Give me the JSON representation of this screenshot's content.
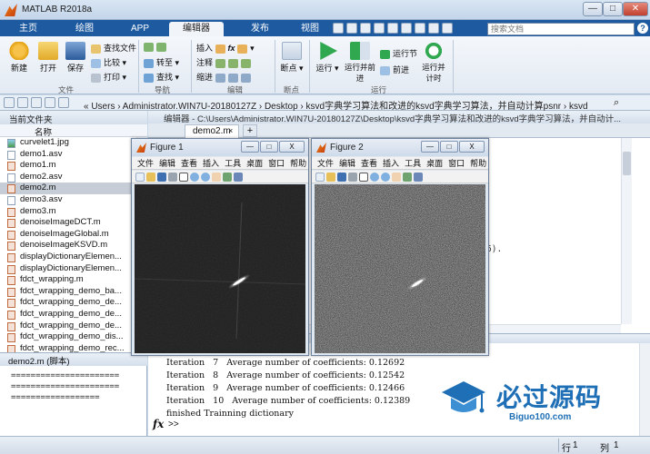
{
  "window": {
    "title": "MATLAB R2018a"
  },
  "tabs": [
    "主页",
    "绘图",
    "APP",
    "编辑器",
    "发布",
    "视图"
  ],
  "active_tab": 3,
  "search": {
    "placeholder": "搜索文档"
  },
  "ribbon": {
    "file_group": {
      "label": "文件",
      "new": "新建",
      "open": "打开",
      "save": "保存",
      "find_files": "查找文件",
      "compare": "比较",
      "print": "打印"
    },
    "nav_group": {
      "label": "导航",
      "goto": "转至",
      "find": "查找"
    },
    "edit_group": {
      "label": "编辑",
      "insert": "插入",
      "comment": "注释",
      "indent": "缩进"
    },
    "breakpoint_group": {
      "label": "断点",
      "breakpoints": "断点"
    },
    "run_group": {
      "label": "运行",
      "run": "运行",
      "run_advance": "运行并前进",
      "run_section": "运行节",
      "advance": "前进",
      "run_time": "运行并计时"
    }
  },
  "address": {
    "path": "« Users › Administrator.WIN7U-20180127Z › Desktop › ksvd字典学习算法和改进的ksvd字典学习算法，并自动计算psnr › ksvd"
  },
  "current_folder": {
    "title": "当前文件夹",
    "column": "名称",
    "files": [
      {
        "name": "curvelet1.jpg",
        "type": "img"
      },
      {
        "name": "demo1.asv",
        "type": "asv"
      },
      {
        "name": "demo1.m",
        "type": "m"
      },
      {
        "name": "demo2.asv",
        "type": "asv"
      },
      {
        "name": "demo2.m",
        "type": "m"
      },
      {
        "name": "demo3.asv",
        "type": "asv"
      },
      {
        "name": "demo3.m",
        "type": "m"
      },
      {
        "name": "denoiseImageDCT.m",
        "type": "m"
      },
      {
        "name": "denoiseImageGlobal.m",
        "type": "m"
      },
      {
        "name": "denoiseImageKSVD.m",
        "type": "m"
      },
      {
        "name": "displayDictionaryElemen...",
        "type": "m"
      },
      {
        "name": "displayDictionaryElemen...",
        "type": "m"
      },
      {
        "name": "fdct_wrapping.m",
        "type": "m"
      },
      {
        "name": "fdct_wrapping_demo_ba...",
        "type": "m"
      },
      {
        "name": "fdct_wrapping_demo_de...",
        "type": "m"
      },
      {
        "name": "fdct_wrapping_demo_de...",
        "type": "m"
      },
      {
        "name": "fdct_wrapping_demo_de...",
        "type": "m"
      },
      {
        "name": "fdct_wrapping_demo_dis...",
        "type": "m"
      },
      {
        "name": "fdct_wrapping_demo_rec...",
        "type": "m"
      }
    ],
    "selected_index": 4
  },
  "details": {
    "title": "demo2.m  (脚本)",
    "lines": [
      "======================",
      "======================",
      "=================="
    ]
  },
  "editor": {
    "title": "编辑器 - C:\\Users\\Administrator.WIN7U-20180127Z\\Desktop\\ksvd字典学习算法和改进的ksvd字典学习算法，并自动计...",
    "tab": "demo2.m",
    "tab_close": "×",
    "tab_add": "+",
    "visible_fragment": "6)."
  },
  "command": {
    "lines": [
      "Iteration   7   Average number of coefficients: 0.12692",
      "Iteration   8   Average number of coefficients: 0.12542",
      "Iteration   9   Average number of coefficients: 0.12466",
      "Iteration   10   Average number of coefficients: 0.12389",
      "finished Trainning dictionary"
    ],
    "prompt": ">>",
    "fx": "fx"
  },
  "figures": [
    {
      "name": "Figure 1",
      "menu": [
        "文件",
        "编辑",
        "查看",
        "插入",
        "工具",
        "桌面",
        "窗口",
        "帮助"
      ],
      "style": "dark"
    },
    {
      "name": "Figure 2",
      "menu": [
        "文件",
        "编辑",
        "查看",
        "插入",
        "工具",
        "桌面",
        "窗口",
        "帮助"
      ],
      "style": "noisy"
    }
  ],
  "figure_buttons": {
    "minimize": "—",
    "maximize": "□",
    "close": "X"
  },
  "watermark": {
    "cn": "必过源码",
    "en": "Biguo100.com"
  },
  "status": {
    "row_label": "行",
    "row": "1",
    "col_label": "列",
    "col": "1"
  },
  "colors": {
    "ribbon_blue": "#1e5aa0",
    "accent": "#1e6fb5"
  }
}
